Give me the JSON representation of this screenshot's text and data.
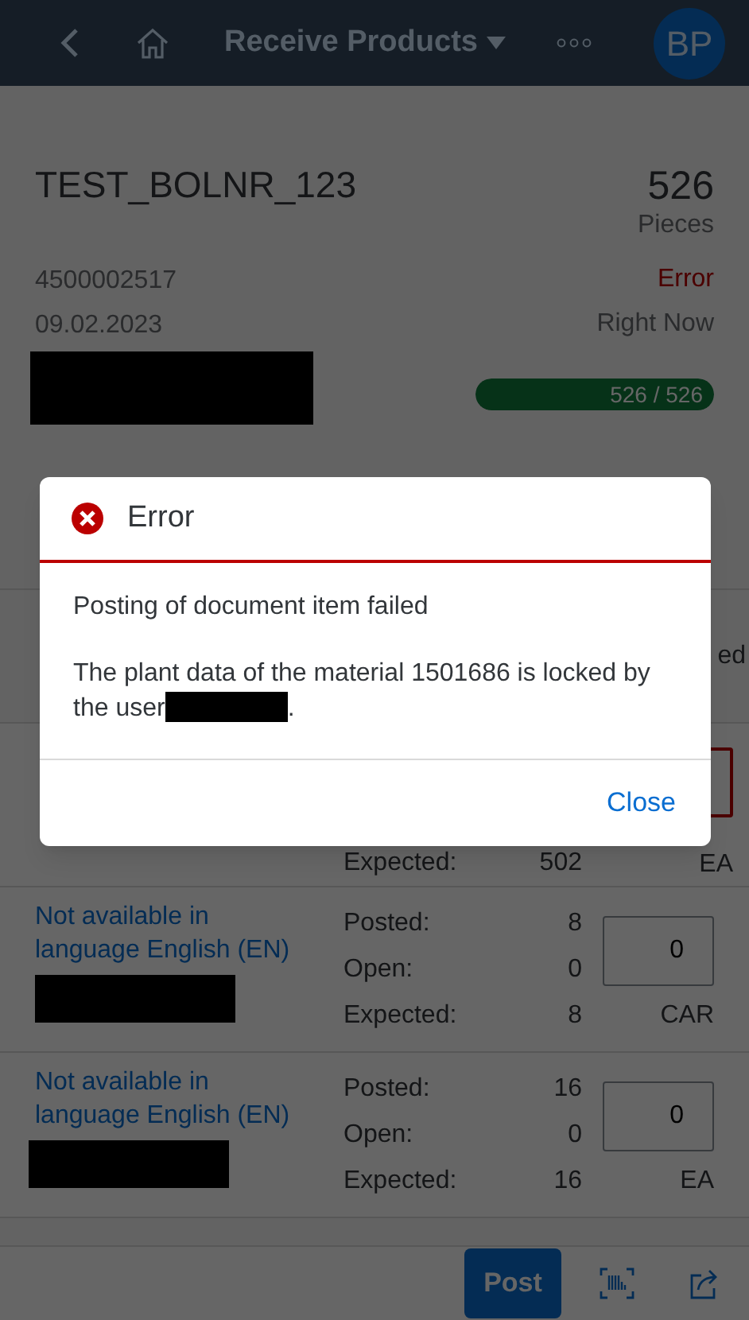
{
  "shell": {
    "title": "Receive Products",
    "avatar": "BP"
  },
  "header": {
    "title": "TEST_BOLNR_123",
    "count": "526",
    "count_unit": "Pieces",
    "number": "4500002517",
    "date": "09.02.2023",
    "status": "Error",
    "status_error": true,
    "time": "Right Now",
    "progress": {
      "level": 1,
      "label": "526 / 526"
    }
  },
  "column_header_fragment": "ed",
  "items": [
    {
      "kind": "partial",
      "stats": [
        {
          "label": "Expected:",
          "value": "502"
        }
      ],
      "unit": "EA",
      "error": true
    },
    {
      "kind": "full",
      "name": "Not available in language English (EN)",
      "stats": [
        {
          "label": "Posted:",
          "value": "8"
        },
        {
          "label": "Open:",
          "value": "0"
        },
        {
          "label": "Expected:",
          "value": "8"
        }
      ],
      "quantity": "0",
      "unit": "CAR",
      "error": false
    },
    {
      "kind": "full",
      "name": "Not available in language English (EN)",
      "stats": [
        {
          "label": "Posted:",
          "value": "16"
        },
        {
          "label": "Open:",
          "value": "0"
        },
        {
          "label": "Expected:",
          "value": "16"
        }
      ],
      "quantity": "0",
      "unit": "EA",
      "error": false
    }
  ],
  "dialog": {
    "title": "Error",
    "messages": [
      "Posting of document item failed",
      "The plant data of the material 1501686 is locked by the user"
    ],
    "message_suffix": ".",
    "close": "Close"
  },
  "footer": {
    "post": "Post"
  }
}
